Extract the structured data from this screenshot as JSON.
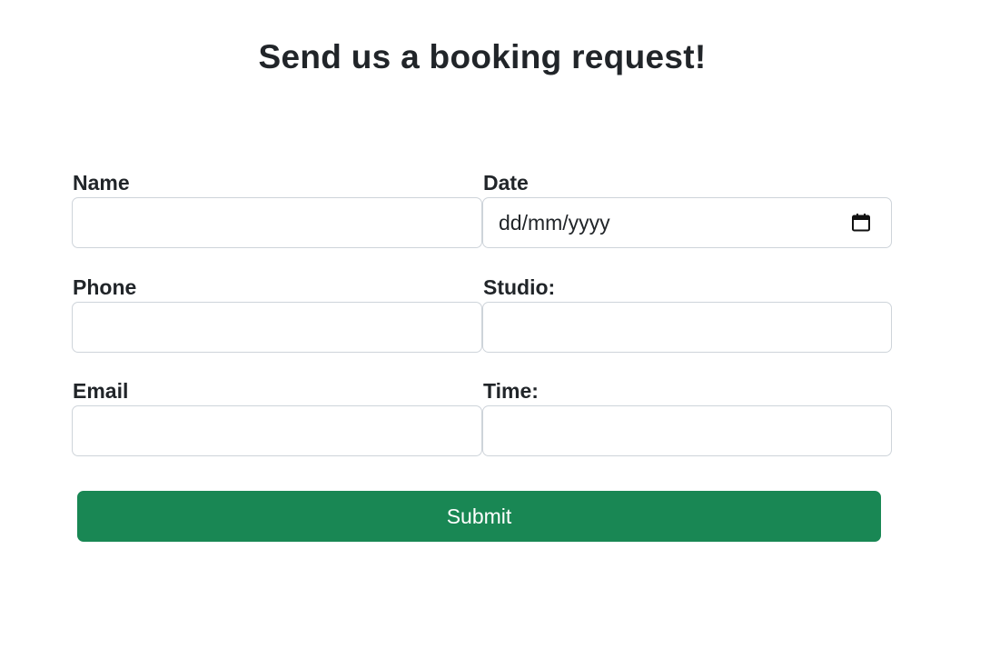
{
  "page": {
    "title": "Send us a booking request!"
  },
  "form": {
    "name": {
      "label": "Name",
      "value": ""
    },
    "date": {
      "label": "Date",
      "placeholder": "dd/mm/yyyy",
      "value": ""
    },
    "phone": {
      "label": "Phone",
      "value": ""
    },
    "studio": {
      "label": "Studio:",
      "value": ""
    },
    "email": {
      "label": "Email",
      "value": ""
    },
    "time": {
      "label": "Time:",
      "value": ""
    },
    "submit_label": "Submit"
  },
  "icons": {
    "date_picker": "calendar-icon"
  },
  "colors": {
    "submit_background": "#198754",
    "submit_text": "#ffffff",
    "input_border": "#ced4da",
    "text": "#212529"
  }
}
